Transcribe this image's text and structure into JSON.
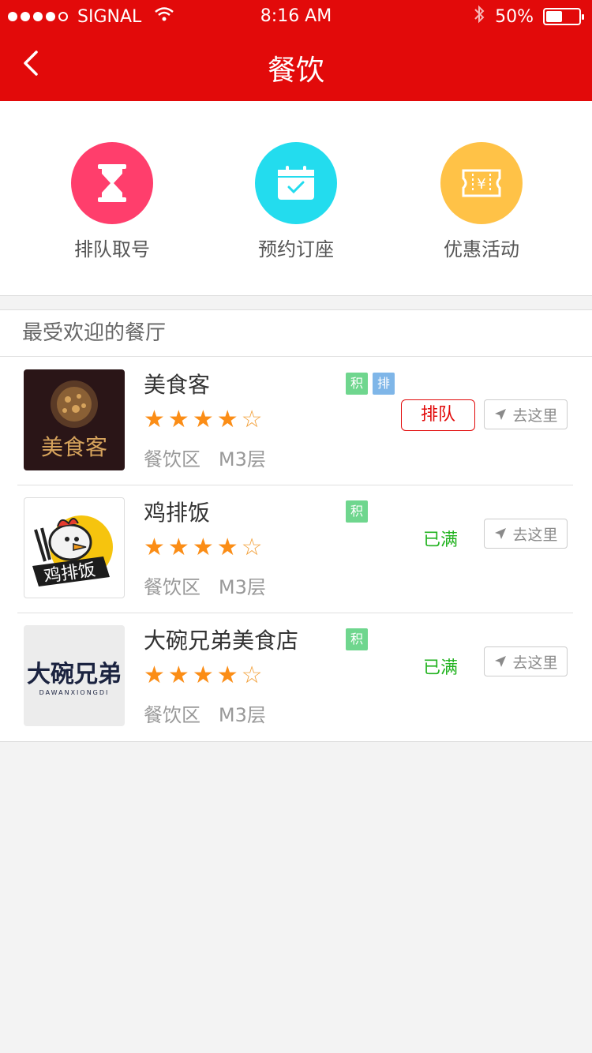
{
  "status_bar": {
    "carrier": "SIGNAL",
    "time": "8:16 AM",
    "battery": "50%",
    "battery_level": 0.5
  },
  "nav": {
    "title": "餐饮",
    "back_icon": "chevron-left-icon"
  },
  "categories": [
    {
      "label": "排队取号",
      "icon": "hourglass-icon",
      "color": "#ff3e6c"
    },
    {
      "label": "预约订座",
      "icon": "calendar-check-icon",
      "color": "#23dcee"
    },
    {
      "label": "优惠活动",
      "icon": "coupon-yen-icon",
      "color": "#ffc247"
    }
  ],
  "section": {
    "title": "最受欢迎的餐厅"
  },
  "restaurants": [
    {
      "name": "美食客",
      "tags": [
        "积",
        "排"
      ],
      "rating": 4,
      "location": "餐饮区   M3层",
      "action": "排队",
      "goto": "去这里",
      "logo_text": "美食客"
    },
    {
      "name": "鸡排饭",
      "tags": [
        "积"
      ],
      "rating": 4,
      "location": "餐饮区   M3层",
      "status": "已满",
      "goto": "去这里",
      "logo_text": "鸡排饭"
    },
    {
      "name": "大碗兄弟美食店",
      "tags": [
        "积"
      ],
      "rating": 4,
      "location": "餐饮区   M3层",
      "status": "已满",
      "goto": "去这里",
      "logo_text": "大碗兄弟",
      "logo_subtext": "DAWANXIONGDI"
    }
  ],
  "colors": {
    "brand_red": "#e20a0a",
    "star": "#fb8d16",
    "status_full": "#23b321",
    "tag_ji": "#6fd68e",
    "tag_pai": "#7fb6e8"
  }
}
